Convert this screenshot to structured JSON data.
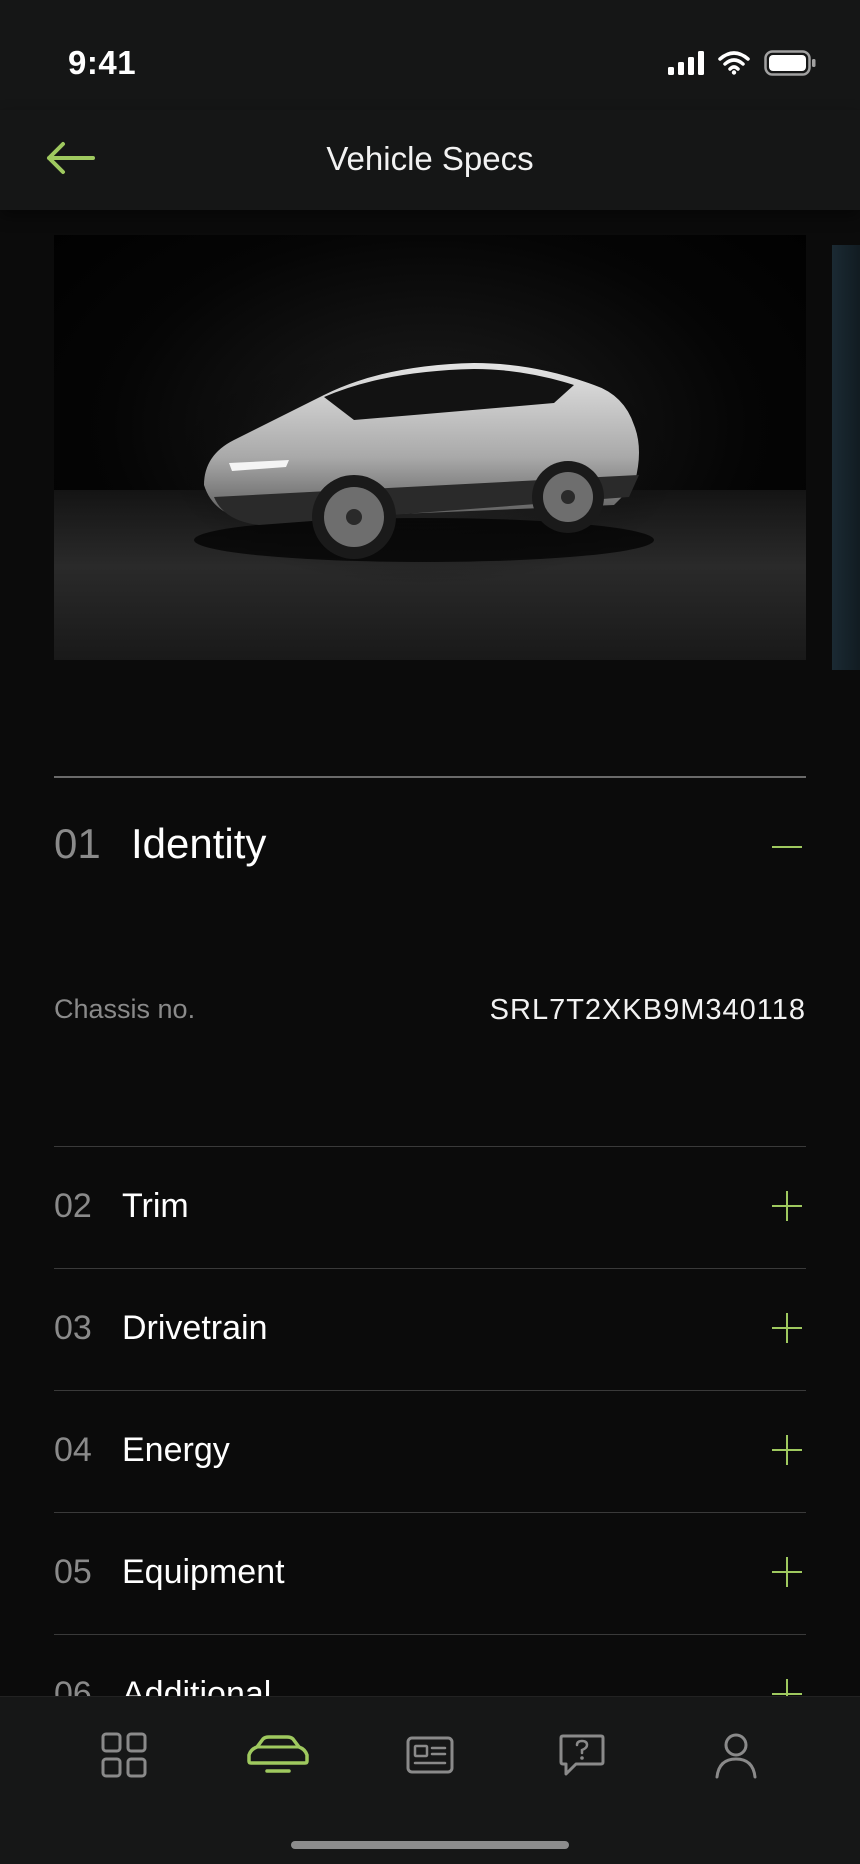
{
  "status_bar": {
    "time": "9:41",
    "icons": [
      "signal-icon",
      "wifi-icon",
      "battery-icon"
    ]
  },
  "nav": {
    "title": "Vehicle Specs",
    "back_icon": "arrow-left-icon"
  },
  "gallery": {
    "images": [
      "car-photo-front",
      "car-photo-next"
    ]
  },
  "sections": [
    {
      "number": "01",
      "title": "Identity",
      "expanded": true,
      "toggle_icon": "minus-icon",
      "specs": [
        {
          "label": "Chassis no.",
          "value": "SRL7T2XKB9M340118"
        }
      ]
    },
    {
      "number": "02",
      "title": "Trim",
      "expanded": false,
      "toggle_icon": "plus-icon"
    },
    {
      "number": "03",
      "title": "Drivetrain",
      "expanded": false,
      "toggle_icon": "plus-icon"
    },
    {
      "number": "04",
      "title": "Energy",
      "expanded": false,
      "toggle_icon": "plus-icon"
    },
    {
      "number": "05",
      "title": "Equipment",
      "expanded": false,
      "toggle_icon": "plus-icon"
    },
    {
      "number": "06",
      "title": "Additional",
      "expanded": false,
      "toggle_icon": "plus-icon"
    }
  ],
  "tab_bar": {
    "tabs": [
      {
        "icon": "grid-icon",
        "active": false
      },
      {
        "icon": "car-icon",
        "active": true
      },
      {
        "icon": "id-card-icon",
        "active": false
      },
      {
        "icon": "help-chat-icon",
        "active": false
      },
      {
        "icon": "profile-icon",
        "active": false
      }
    ]
  },
  "colors": {
    "accent": "#9fc95f",
    "background": "#0b0b0b",
    "bar": "#151616",
    "muted_text": "#8a8a8a"
  }
}
